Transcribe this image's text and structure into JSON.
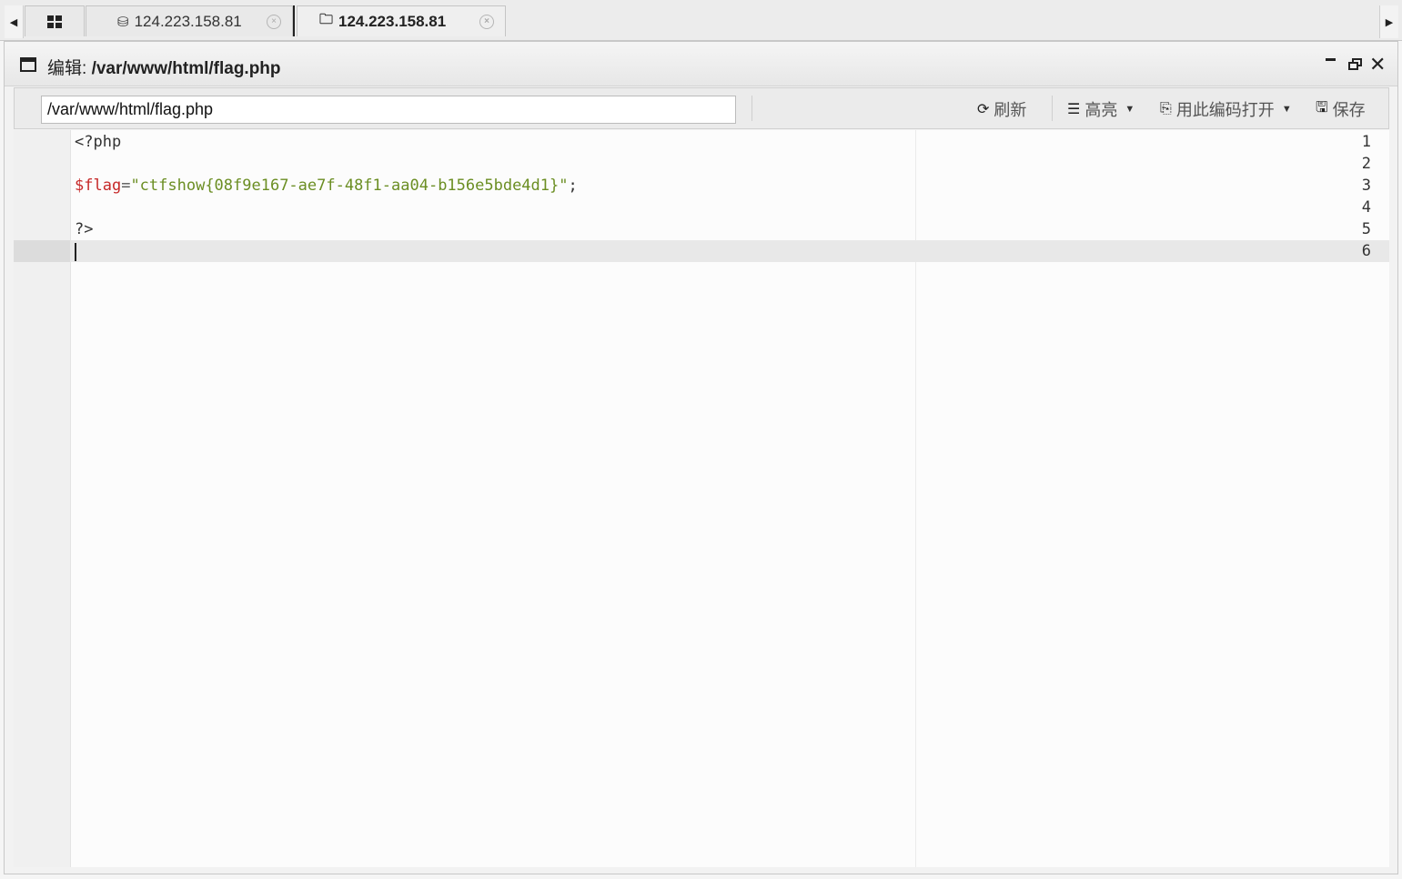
{
  "tabs": {
    "home_icon": "grid-icon",
    "items": [
      {
        "icon": "database-icon",
        "label": "124.223.158.81",
        "active": false
      },
      {
        "icon": "folder-icon",
        "label": "124.223.158.81",
        "active": true
      }
    ]
  },
  "window": {
    "title_label": "编辑:",
    "title_path": "/var/www/html/flag.php"
  },
  "toolbar": {
    "path_value": "/var/www/html/flag.php",
    "refresh_label": "刷新",
    "highlight_label": "高亮",
    "encoding_label": "用此编码打开",
    "save_label": "保存"
  },
  "code": {
    "active_line": 6,
    "lines": [
      {
        "num": "1",
        "text": "<?php"
      },
      {
        "num": "2",
        "text": ""
      },
      {
        "num": "3",
        "var": "$flag",
        "op": "=",
        "str": "\"ctfshow{08f9e167-ae7f-48f1-aa04-b156e5bde4d1}\"",
        "end": ";"
      },
      {
        "num": "4",
        "text": ""
      },
      {
        "num": "5",
        "text": "?>"
      },
      {
        "num": "6",
        "text": ""
      }
    ]
  }
}
